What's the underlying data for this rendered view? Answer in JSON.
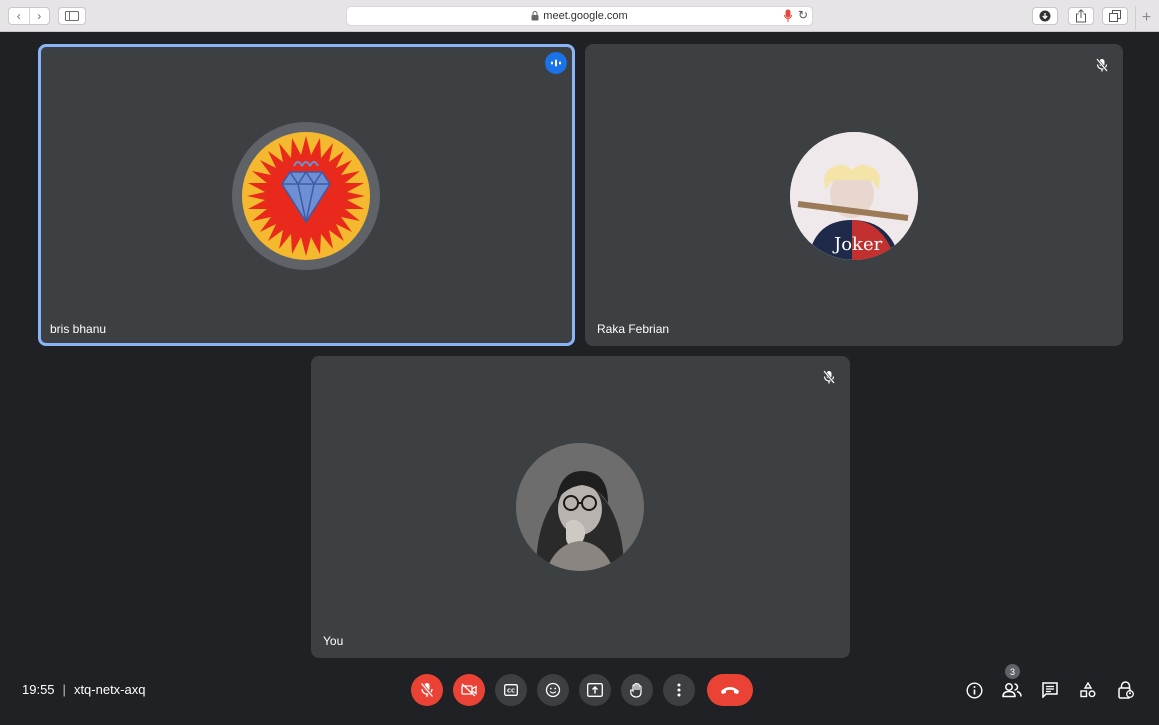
{
  "browser": {
    "url": "meet.google.com",
    "nav_back": "‹",
    "nav_forward": "›",
    "new_tab": "+"
  },
  "tiles": [
    {
      "name": "bris bhanu",
      "speaking": true
    },
    {
      "name": "Raka Febrian",
      "muted": true
    },
    {
      "name": "You",
      "muted": true
    }
  ],
  "meeting": {
    "time": "19:55",
    "separator": "|",
    "code": "xtq-netx-axq",
    "participants_count": "3"
  },
  "colors": {
    "background": "#202124",
    "tile": "#3c4043",
    "active_outline": "#8ab4f8",
    "danger": "#ea4335",
    "speaking_badge": "#1a73e8"
  }
}
